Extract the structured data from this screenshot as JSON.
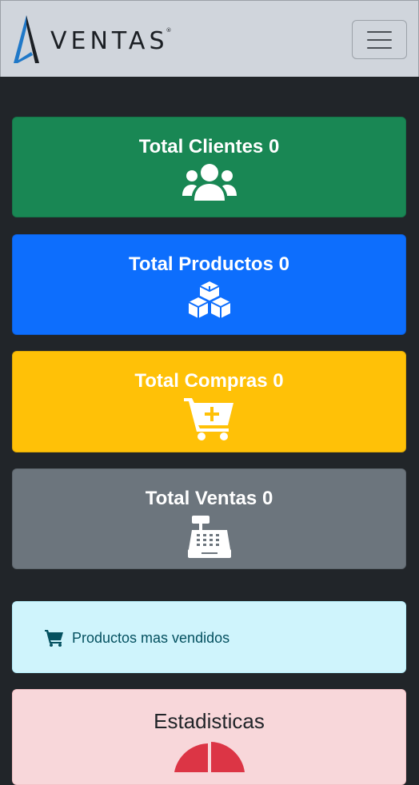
{
  "navbar": {
    "brand": "VENTAS",
    "brand_mark": "®",
    "logo_icon": "ventas-logo-icon",
    "toggler_icon": "hamburger-icon"
  },
  "cards": [
    {
      "title": "Total Clientes",
      "count": "0",
      "icon": "users-icon",
      "color": "#198754"
    },
    {
      "title": "Total Productos",
      "count": "0",
      "icon": "boxes-icon",
      "color": "#0d6efd"
    },
    {
      "title": "Total Compras",
      "count": "0",
      "icon": "cart-plus-icon",
      "color": "#ffc107"
    },
    {
      "title": "Total Ventas",
      "count": "0",
      "icon": "cash-register-icon",
      "color": "#6c757d"
    }
  ],
  "top_products": {
    "label": "Productos mas vendidos",
    "icon": "shopping-cart-icon"
  },
  "stats": {
    "title": "Estadisticas",
    "chart_icon": "pie-chart"
  }
}
